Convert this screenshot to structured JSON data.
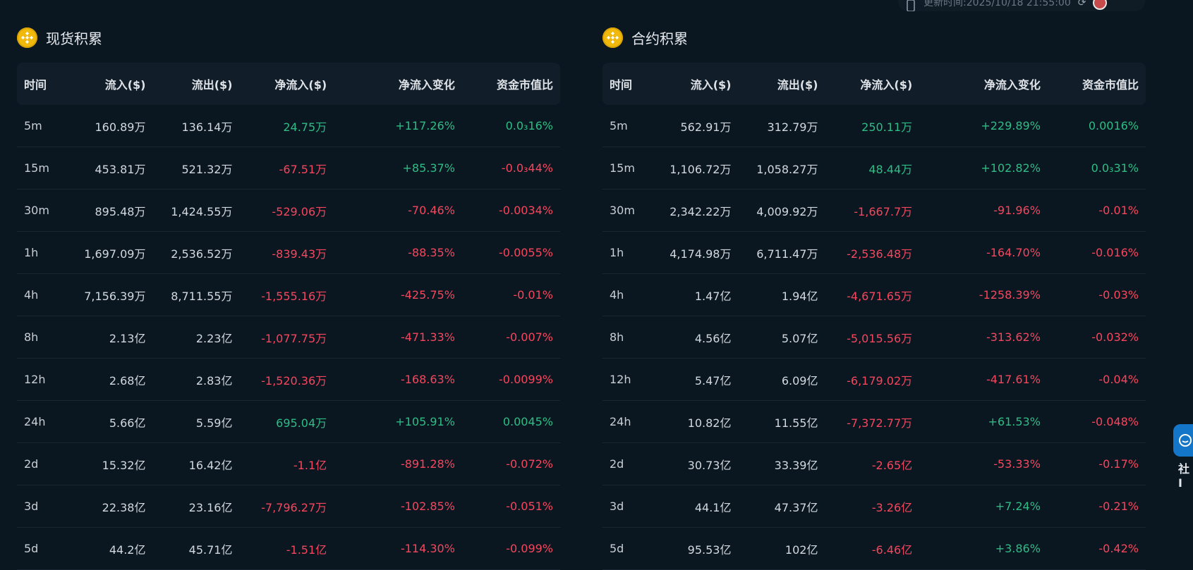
{
  "topbar": {
    "update_label": "更新时间:2025/10/18 21:55:00"
  },
  "spot": {
    "title": "现货积累",
    "headers": [
      "时间",
      "流入($)",
      "流出($)",
      "净流入($)",
      "净流入变化",
      "资金市值比"
    ],
    "rows": [
      {
        "time": "5m",
        "inflow": "160.89万",
        "outflow": "136.14万",
        "net": "24.75万",
        "net_sign": "pos",
        "change": "+117.26%",
        "change_sign": "pos",
        "ratio": "0.0₃16%",
        "ratio_sign": "pos"
      },
      {
        "time": "15m",
        "inflow": "453.81万",
        "outflow": "521.32万",
        "net": "-67.51万",
        "net_sign": "neg",
        "change": "+85.37%",
        "change_sign": "pos",
        "ratio": "-0.0₃44%",
        "ratio_sign": "neg"
      },
      {
        "time": "30m",
        "inflow": "895.48万",
        "outflow": "1,424.55万",
        "net": "-529.06万",
        "net_sign": "neg",
        "change": "-70.46%",
        "change_sign": "neg",
        "ratio": "-0.0034%",
        "ratio_sign": "neg"
      },
      {
        "time": "1h",
        "inflow": "1,697.09万",
        "outflow": "2,536.52万",
        "net": "-839.43万",
        "net_sign": "neg",
        "change": "-88.35%",
        "change_sign": "neg",
        "ratio": "-0.0055%",
        "ratio_sign": "neg"
      },
      {
        "time": "4h",
        "inflow": "7,156.39万",
        "outflow": "8,711.55万",
        "net": "-1,555.16万",
        "net_sign": "neg",
        "change": "-425.75%",
        "change_sign": "neg",
        "ratio": "-0.01%",
        "ratio_sign": "neg"
      },
      {
        "time": "8h",
        "inflow": "2.13亿",
        "outflow": "2.23亿",
        "net": "-1,077.75万",
        "net_sign": "neg",
        "change": "-471.33%",
        "change_sign": "neg",
        "ratio": "-0.007%",
        "ratio_sign": "neg"
      },
      {
        "time": "12h",
        "inflow": "2.68亿",
        "outflow": "2.83亿",
        "net": "-1,520.36万",
        "net_sign": "neg",
        "change": "-168.63%",
        "change_sign": "neg",
        "ratio": "-0.0099%",
        "ratio_sign": "neg"
      },
      {
        "time": "24h",
        "inflow": "5.66亿",
        "outflow": "5.59亿",
        "net": "695.04万",
        "net_sign": "pos",
        "change": "+105.91%",
        "change_sign": "pos",
        "ratio": "0.0045%",
        "ratio_sign": "pos"
      },
      {
        "time": "2d",
        "inflow": "15.32亿",
        "outflow": "16.42亿",
        "net": "-1.1亿",
        "net_sign": "neg",
        "change": "-891.28%",
        "change_sign": "neg",
        "ratio": "-0.072%",
        "ratio_sign": "neg"
      },
      {
        "time": "3d",
        "inflow": "22.38亿",
        "outflow": "23.16亿",
        "net": "-7,796.27万",
        "net_sign": "neg",
        "change": "-102.85%",
        "change_sign": "neg",
        "ratio": "-0.051%",
        "ratio_sign": "neg"
      },
      {
        "time": "5d",
        "inflow": "44.2亿",
        "outflow": "45.71亿",
        "net": "-1.51亿",
        "net_sign": "neg",
        "change": "-114.30%",
        "change_sign": "neg",
        "ratio": "-0.099%",
        "ratio_sign": "neg"
      }
    ]
  },
  "futures": {
    "title": "合约积累",
    "headers": [
      "时间",
      "流入($)",
      "流出($)",
      "净流入($)",
      "净流入变化",
      "资金市值比"
    ],
    "rows": [
      {
        "time": "5m",
        "inflow": "562.91万",
        "outflow": "312.79万",
        "net": "250.11万",
        "net_sign": "pos",
        "change": "+229.89%",
        "change_sign": "pos",
        "ratio": "0.0016%",
        "ratio_sign": "pos"
      },
      {
        "time": "15m",
        "inflow": "1,106.72万",
        "outflow": "1,058.27万",
        "net": "48.44万",
        "net_sign": "pos",
        "change": "+102.82%",
        "change_sign": "pos",
        "ratio": "0.0₃31%",
        "ratio_sign": "pos"
      },
      {
        "time": "30m",
        "inflow": "2,342.22万",
        "outflow": "4,009.92万",
        "net": "-1,667.7万",
        "net_sign": "neg",
        "change": "-91.96%",
        "change_sign": "neg",
        "ratio": "-0.01%",
        "ratio_sign": "neg"
      },
      {
        "time": "1h",
        "inflow": "4,174.98万",
        "outflow": "6,711.47万",
        "net": "-2,536.48万",
        "net_sign": "neg",
        "change": "-164.70%",
        "change_sign": "neg",
        "ratio": "-0.016%",
        "ratio_sign": "neg"
      },
      {
        "time": "4h",
        "inflow": "1.47亿",
        "outflow": "1.94亿",
        "net": "-4,671.65万",
        "net_sign": "neg",
        "change": "-1258.39%",
        "change_sign": "neg",
        "ratio": "-0.03%",
        "ratio_sign": "neg"
      },
      {
        "time": "8h",
        "inflow": "4.56亿",
        "outflow": "5.07亿",
        "net": "-5,015.56万",
        "net_sign": "neg",
        "change": "-313.62%",
        "change_sign": "neg",
        "ratio": "-0.032%",
        "ratio_sign": "neg"
      },
      {
        "time": "12h",
        "inflow": "5.47亿",
        "outflow": "6.09亿",
        "net": "-6,179.02万",
        "net_sign": "neg",
        "change": "-417.61%",
        "change_sign": "neg",
        "ratio": "-0.04%",
        "ratio_sign": "neg"
      },
      {
        "time": "24h",
        "inflow": "10.82亿",
        "outflow": "11.55亿",
        "net": "-7,372.77万",
        "net_sign": "neg",
        "change": "+61.53%",
        "change_sign": "pos",
        "ratio": "-0.048%",
        "ratio_sign": "neg"
      },
      {
        "time": "2d",
        "inflow": "30.73亿",
        "outflow": "33.39亿",
        "net": "-2.65亿",
        "net_sign": "neg",
        "change": "-53.33%",
        "change_sign": "neg",
        "ratio": "-0.17%",
        "ratio_sign": "neg"
      },
      {
        "time": "3d",
        "inflow": "44.1亿",
        "outflow": "47.37亿",
        "net": "-3.26亿",
        "net_sign": "neg",
        "change": "+7.24%",
        "change_sign": "pos",
        "ratio": "-0.21%",
        "ratio_sign": "neg"
      },
      {
        "time": "5d",
        "inflow": "95.53亿",
        "outflow": "102亿",
        "net": "-6.46亿",
        "net_sign": "neg",
        "change": "+3.86%",
        "change_sign": "pos",
        "ratio": "-0.42%",
        "ratio_sign": "neg"
      }
    ]
  },
  "side_widget": {
    "label": "社I",
    "icon": "chat-icon"
  },
  "colors": {
    "positive": "#2ebd85",
    "negative": "#f6465d",
    "background": "#0a1721",
    "header_bg": "#111e2a",
    "coin": "#f0b90b"
  }
}
